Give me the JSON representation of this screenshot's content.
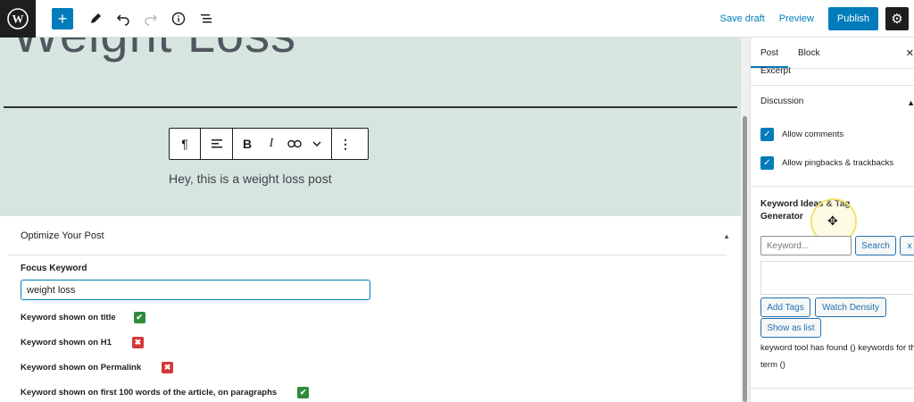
{
  "toolbar": {
    "add_label": "+",
    "save_draft": "Save draft",
    "preview": "Preview",
    "publish": "Publish"
  },
  "editor": {
    "post_title": "Weight Loss",
    "paragraph": "Hey, this is a weight loss post",
    "block_toolbar": [
      "¶",
      "B",
      "I"
    ]
  },
  "optimize": {
    "title": "Optimize Your Post",
    "focus_label": "Focus Keyword",
    "focus_value": "weight loss",
    "checks": [
      {
        "label": "Keyword shown on title",
        "status": "pass",
        "symbol": "✔"
      },
      {
        "label": "Keyword shown on H1",
        "status": "fail",
        "symbol": "✖"
      },
      {
        "label": "Keyword shown on Permalink",
        "status": "fail",
        "symbol": "✖"
      },
      {
        "label": "Keyword shown on first 100 words of the article, on paragraphs",
        "status": "pass",
        "symbol": "✔"
      }
    ]
  },
  "sidebar": {
    "tabs": [
      "Post",
      "Block"
    ],
    "excerpt": "Excerpt",
    "discussion": "Discussion",
    "allow_comments": "Allow comments",
    "allow_pingbacks": "Allow pingbacks & trackbacks",
    "keyword_title": "Keyword Ideas & Tag Generator",
    "keyword_placeholder": "Keyword...",
    "search_btn": "Search",
    "clear_btn": "x",
    "add_tags_btn": "Add Tags",
    "watch_density_btn": "Watch Density",
    "show_list_btn": "Show as list",
    "status_text": "keyword tool has found () keywords for the term ()"
  },
  "colors": {
    "accent": "#007cba",
    "editor_bg": "#d7e5e0",
    "pass": "#2e8b3a",
    "fail": "#d63638"
  }
}
